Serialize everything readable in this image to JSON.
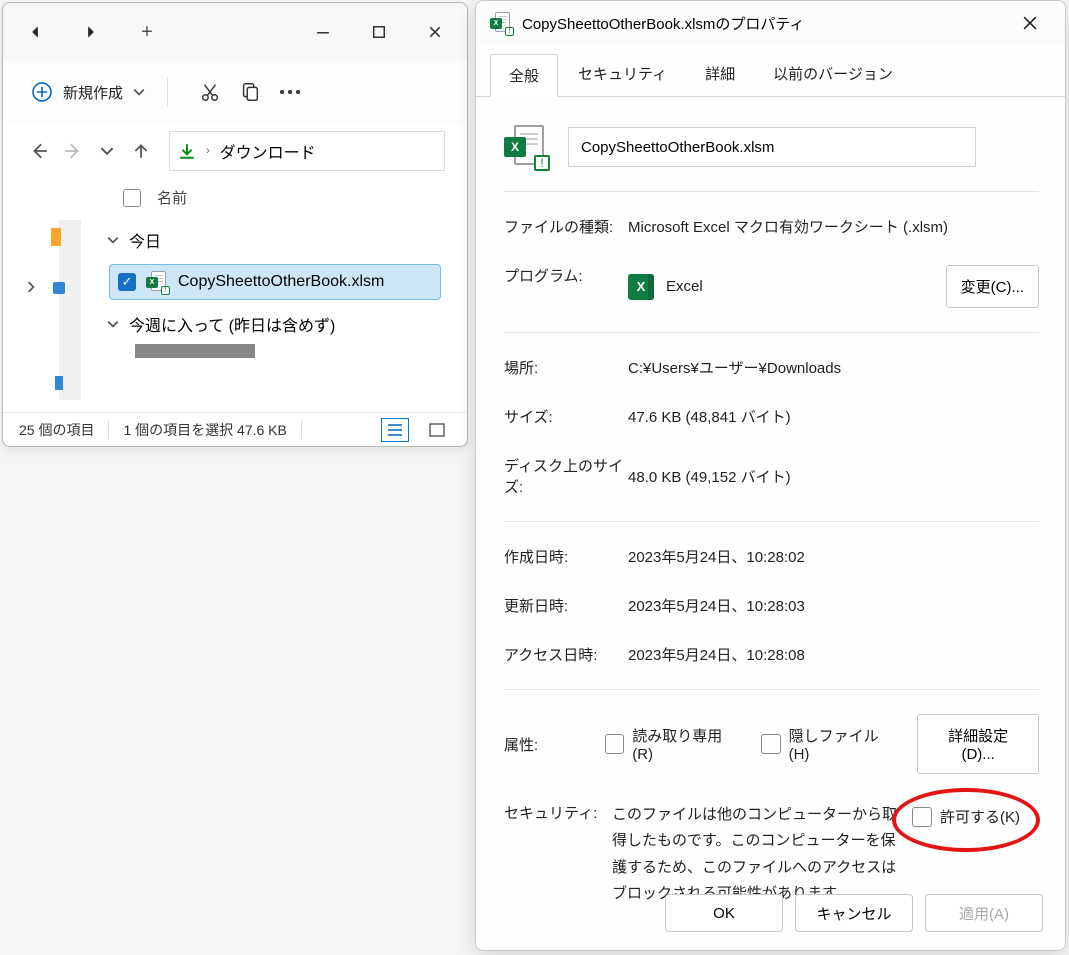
{
  "explorer": {
    "new_label": "新規作成",
    "breadcrumb": "ダウンロード",
    "header_name": "名前",
    "groups": {
      "today": "今日",
      "week": "今週に入って (昨日は含めず)"
    },
    "file_name": "CopySheettoOtherBook.xlsm",
    "status": {
      "items": "25 個の項目",
      "selection": "1 個の項目を選択 47.6 KB"
    }
  },
  "props": {
    "title": "CopySheettoOtherBook.xlsmのプロパティ",
    "tabs": {
      "general": "全般",
      "security": "セキュリティ",
      "details": "詳細",
      "prev": "以前のバージョン"
    },
    "filename": "CopySheettoOtherBook.xlsm",
    "labels": {
      "filetype": "ファイルの種類:",
      "program": "プログラム:",
      "change": "変更(C)...",
      "location": "場所:",
      "size": "サイズ:",
      "disk": "ディスク上のサイズ:",
      "created": "作成日時:",
      "modified": "更新日時:",
      "accessed": "アクセス日時:",
      "attributes": "属性:",
      "readonly": "読み取り専用(R)",
      "hidden": "隠しファイル(H)",
      "advanced": "詳細設定(D)...",
      "security": "セキュリティ:",
      "allow": "許可する(K)"
    },
    "values": {
      "filetype": "Microsoft Excel マクロ有効ワークシート (.xlsm)",
      "program": "Excel",
      "location": "C:¥Users¥ユーザー¥Downloads",
      "size": "47.6 KB (48,841 バイト)",
      "disk": "48.0 KB (49,152 バイト)",
      "created": "2023年5月24日、10:28:02",
      "modified": "2023年5月24日、10:28:03",
      "accessed": "2023年5月24日、10:28:08",
      "security_text": "このファイルは他のコンピューターから取得したものです。このコンピューターを保護するため、このファイルへのアクセスはブロックされる可能性があります。"
    },
    "buttons": {
      "ok": "OK",
      "cancel": "キャンセル",
      "apply": "適用(A)"
    }
  }
}
